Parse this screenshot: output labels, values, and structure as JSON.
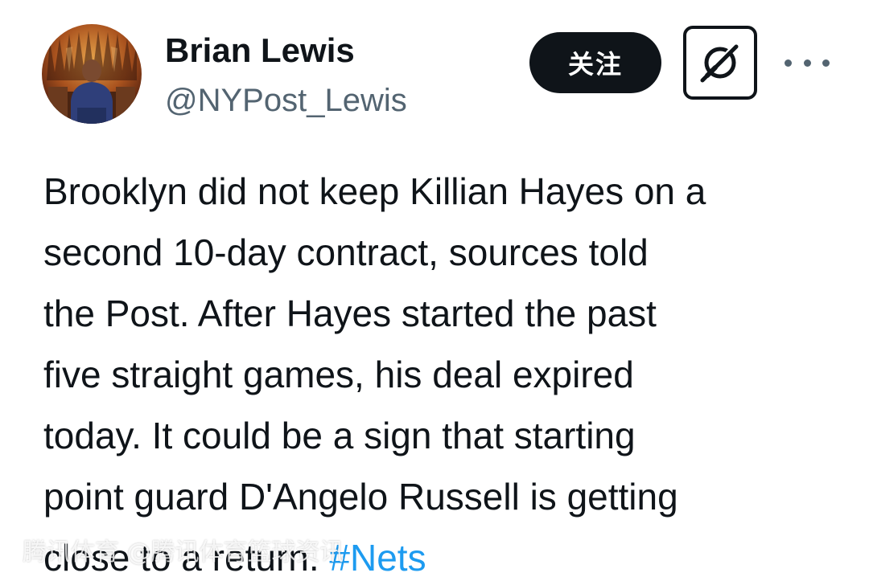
{
  "author": {
    "display_name": "Brian Lewis",
    "handle": "@NYPost_Lewis",
    "avatar_icon": "user-avatar-photo"
  },
  "actions": {
    "follow_label": "关注",
    "grok_icon": "grok-icon",
    "more_icon": "more-options-icon"
  },
  "tweet": {
    "lines": [
      "Brooklyn did not keep Killian Hayes on a",
      "second 10-day contract, sources told",
      "the Post. After Hayes started the past",
      "five straight games, his deal expired",
      "today. It could be a sign that starting",
      "point guard D'Angelo Russell is getting",
      "close to a return."
    ],
    "hashtag": "#Nets"
  },
  "watermark": "腾讯体育 @腾讯体育篮球资讯",
  "colors": {
    "text": "#0f1419",
    "secondary": "#536471",
    "link": "#1d9bf0",
    "follow_bg": "#0f1419"
  }
}
